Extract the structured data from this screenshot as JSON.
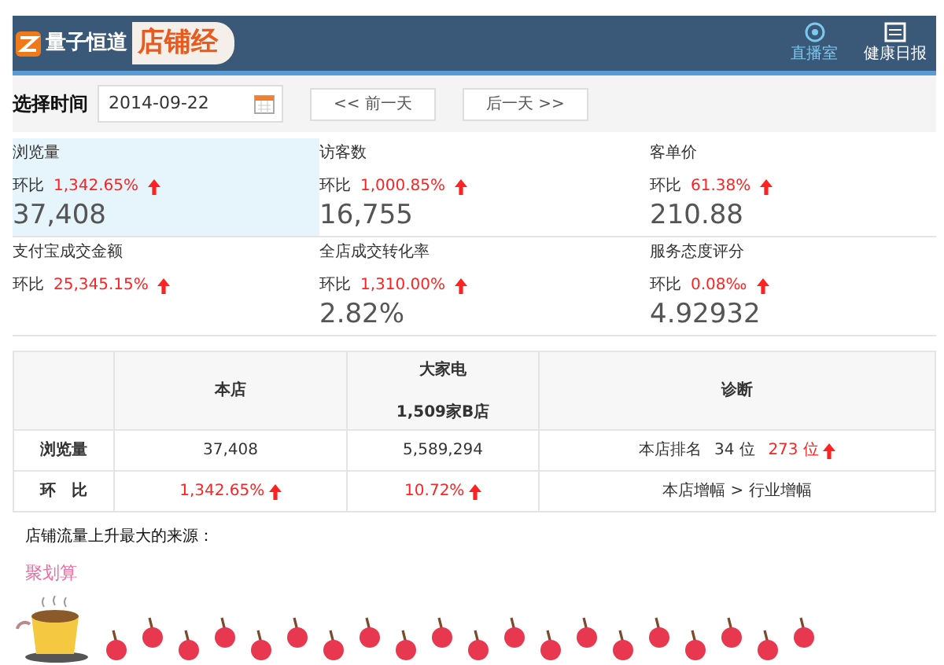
{
  "header": {
    "logo": "量子恒道",
    "product": "店铺经",
    "links": [
      {
        "label": "直播室",
        "kind": "live"
      },
      {
        "label": "健康日报",
        "kind": "report"
      }
    ]
  },
  "date_picker": {
    "label": "选择时间",
    "value": "2014-09-22",
    "prev": "<< 前一天",
    "next": "后一天 >>"
  },
  "metrics": [
    {
      "name": "浏览量",
      "compare_label": "环比",
      "change": "1,342.65%",
      "rising": true,
      "value": "37,408",
      "selected": true
    },
    {
      "name": "访客数",
      "compare_label": "环比",
      "change": "1,000.85%",
      "rising": true,
      "value": "16,755",
      "selected": false
    },
    {
      "name": "客单价",
      "compare_label": "环比",
      "change": "61.38%",
      "rising": true,
      "value": "210.88",
      "selected": false
    },
    {
      "name": "支付宝成交金额",
      "compare_label": "环比",
      "change": "25,345.15%",
      "rising": true,
      "selected": false
    },
    {
      "name": "全店成交转化率",
      "compare_label": "环比",
      "change": "1,310.00%",
      "rising": true,
      "value": "2.82%",
      "selected": false
    },
    {
      "name": "服务态度评分",
      "compare_label": "环比",
      "change": "0.08‰",
      "rising": true,
      "value": "4.92932",
      "selected": false
    }
  ],
  "table": {
    "columns": [
      {
        "label": "本店"
      },
      {
        "label": "大家电",
        "sublabel": "1,509家B店"
      },
      {
        "label": "诊断"
      }
    ],
    "rows": [
      {
        "label": "浏览量",
        "cells": [
          {
            "kind": "plain",
            "text": "37,408"
          },
          {
            "kind": "plain",
            "text": "5,589,294"
          },
          {
            "kind": "rank",
            "label": "本店排名",
            "rank": "34 位",
            "change": "273 位",
            "rising": true
          }
        ]
      },
      {
        "label": "环　比",
        "cells": [
          {
            "kind": "change",
            "text": "1,342.65%",
            "rising": true
          },
          {
            "kind": "change",
            "text": "10.72%",
            "rising": true
          },
          {
            "kind": "plain",
            "text": "本店增幅 > 行业增幅"
          }
        ]
      }
    ]
  },
  "source": {
    "heading": "店铺流量上升最大的来源：",
    "link": "聚划算"
  }
}
